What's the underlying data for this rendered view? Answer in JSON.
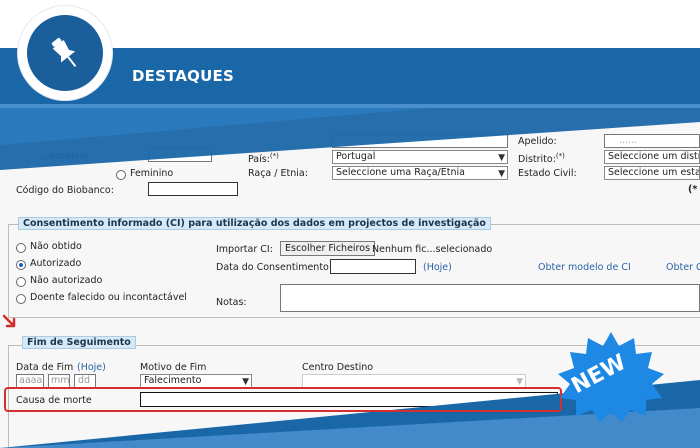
{
  "banner": {
    "title": "DESTAQUES",
    "icon": "pushpin-icon",
    "colors": {
      "band": "#1a67a8",
      "badge": "#1a5f9c"
    }
  },
  "personal": {
    "apelido_label": "Apelido:",
    "apelido_value": "......",
    "sexo_partial": "...asculino",
    "feminino_label": "Feminino",
    "pais_label": "País:",
    "pais_req": "(*)",
    "pais_value": "Portugal",
    "distrito_label": "Distrito:",
    "distrito_req": "(*)",
    "distrito_value": "Seleccione um distri",
    "raca_label": "Raça / Etnia:",
    "raca_value": "Seleccione uma Raça/Etnia",
    "estado_label": "Estado Civil:",
    "estado_value": "Seleccione um esta",
    "biobanco_label": "Código do Biobanco:",
    "biobanco_value": "",
    "req_mark": "(*"
  },
  "consent": {
    "legend": "Consentimento informado (CI) para utilização dos dados em projectos de investigação",
    "options": [
      {
        "label": "Não obtido",
        "checked": false
      },
      {
        "label": "Autorizado",
        "checked": true
      },
      {
        "label": "Não autorizado",
        "checked": false
      },
      {
        "label": "Doente falecido ou incontactável",
        "checked": false
      }
    ],
    "importar_label": "Importar CI:",
    "choose_button": "Escolher Ficheiros",
    "no_file": "Nenhum fic...selecionado",
    "data_label": "Data do Consentimento:",
    "data_value": "",
    "hoje": "(Hoje)",
    "modelo_link": "Obter modelo de CI",
    "modelo_link2": "Obter C",
    "notas_label": "Notas:",
    "notas_value": ""
  },
  "followup": {
    "legend": "Fim de Seguimento",
    "data_fim_label": "Data de Fim",
    "hoje": "(Hoje)",
    "date_placeholders": {
      "year": "aaaa",
      "month": "mm",
      "day": "dd"
    },
    "motivo_label": "Motivo de Fim",
    "motivo_value": "Falecimento",
    "centro_label": "Centro Destino",
    "centro_value": "",
    "causa_label": "Causa de morte",
    "causa_value": ""
  },
  "badge_new": {
    "text": "NEW",
    "color": "#1e88e5"
  },
  "highlight_color": "#d32f2f"
}
